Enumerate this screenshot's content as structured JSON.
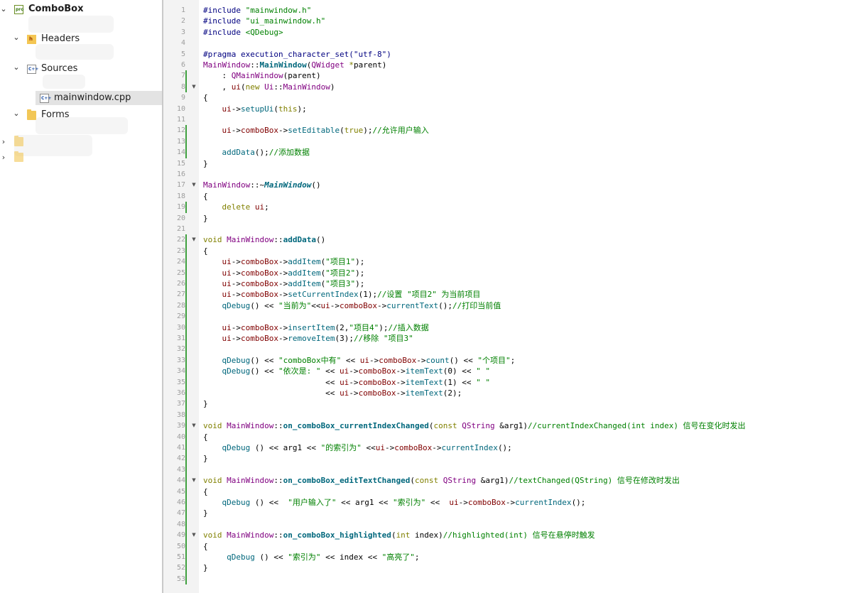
{
  "sidebar": {
    "items": [
      {
        "label": "ComboBox"
      },
      {
        "label": "Headers"
      },
      {
        "label": "Sources"
      },
      {
        "label": "mainwindow.cpp"
      },
      {
        "label": "Forms"
      }
    ]
  },
  "editor": {
    "lines": [
      {
        "n": "1",
        "t": [
          [
            "pre",
            "#include "
          ],
          [
            "str",
            "\"mainwindow.h\""
          ]
        ]
      },
      {
        "n": "2",
        "t": [
          [
            "pre",
            "#include "
          ],
          [
            "str",
            "\"ui_mainwindow.h\""
          ]
        ]
      },
      {
        "n": "3",
        "t": [
          [
            "pre",
            "#include "
          ],
          [
            "str",
            "<QDebug>"
          ]
        ]
      },
      {
        "n": "4",
        "t": []
      },
      {
        "n": "5",
        "t": [
          [
            "pre",
            "#pragma execution_character_set(\"utf-8\")"
          ]
        ]
      },
      {
        "n": "6",
        "t": [
          [
            "ty",
            "MainWindow"
          ],
          [
            "",
            "::"
          ],
          [
            "fnb",
            "MainWindow"
          ],
          [
            "",
            "("
          ],
          [
            "ty",
            "QWidget"
          ],
          [
            "",
            ""
          ],
          [
            "kw",
            " *"
          ],
          [
            "",
            "parent)"
          ]
        ]
      },
      {
        "n": "7",
        "t": [
          [
            "",
            "    : "
          ],
          [
            "ty",
            "QMainWindow"
          ],
          [
            "",
            "(parent)"
          ]
        ]
      },
      {
        "n": "8",
        "t": [
          [
            "",
            "    , "
          ],
          [
            "mb",
            "ui"
          ],
          [
            "",
            "("
          ],
          [
            "kw",
            "new"
          ],
          [
            "",
            ""
          ],
          [
            "ty",
            " Ui"
          ],
          [
            "",
            "::"
          ],
          [
            "ty",
            "MainWindow"
          ],
          [
            "",
            ")"
          ]
        ]
      },
      {
        "n": "9",
        "t": [
          [
            "",
            "{"
          ]
        ]
      },
      {
        "n": "10",
        "t": [
          [
            "",
            "    "
          ],
          [
            "mb",
            "ui"
          ],
          [
            "",
            "->"
          ],
          [
            "fn",
            "setupUi"
          ],
          [
            "",
            "("
          ],
          [
            "kw",
            "this"
          ],
          [
            "",
            ");"
          ]
        ]
      },
      {
        "n": "11",
        "t": []
      },
      {
        "n": "12",
        "t": [
          [
            "",
            "    "
          ],
          [
            "mb",
            "ui"
          ],
          [
            "",
            "->"
          ],
          [
            "mb",
            "comboBox"
          ],
          [
            "",
            "->"
          ],
          [
            "fn",
            "setEditable"
          ],
          [
            "",
            "("
          ],
          [
            "kw",
            "true"
          ],
          [
            "",
            ");"
          ],
          [
            "cm",
            "//允许用户输入"
          ]
        ]
      },
      {
        "n": "13",
        "t": []
      },
      {
        "n": "14",
        "t": [
          [
            "",
            "    "
          ],
          [
            "fn",
            "addData"
          ],
          [
            "",
            "();"
          ],
          [
            "cm",
            "//添加数据"
          ]
        ]
      },
      {
        "n": "15",
        "t": [
          [
            "",
            "}"
          ]
        ]
      },
      {
        "n": "16",
        "t": []
      },
      {
        "n": "17",
        "t": [
          [
            "ty",
            "MainWindow"
          ],
          [
            "",
            "::~"
          ],
          [
            "fni",
            "MainWindow"
          ],
          [
            "",
            "()"
          ]
        ]
      },
      {
        "n": "18",
        "t": [
          [
            "",
            "{"
          ]
        ]
      },
      {
        "n": "19",
        "t": [
          [
            "",
            "    "
          ],
          [
            "kw",
            "delete"
          ],
          [
            "",
            ""
          ],
          [
            "mb",
            " ui"
          ],
          [
            "",
            ";"
          ]
        ]
      },
      {
        "n": "20",
        "t": [
          [
            "",
            "}"
          ]
        ]
      },
      {
        "n": "21",
        "t": []
      },
      {
        "n": "22",
        "t": [
          [
            "kw",
            "void"
          ],
          [
            "",
            ""
          ],
          [
            "ty",
            " MainWindow"
          ],
          [
            "",
            "::"
          ],
          [
            "fnb",
            "addData"
          ],
          [
            "",
            "()"
          ]
        ]
      },
      {
        "n": "23",
        "t": [
          [
            "",
            "{"
          ]
        ]
      },
      {
        "n": "24",
        "t": [
          [
            "",
            "    "
          ],
          [
            "mb",
            "ui"
          ],
          [
            "",
            "->"
          ],
          [
            "mb",
            "comboBox"
          ],
          [
            "",
            "->"
          ],
          [
            "fn",
            "addItem"
          ],
          [
            "",
            "("
          ],
          [
            "str",
            "\"项目1\""
          ],
          [
            "",
            ");"
          ]
        ]
      },
      {
        "n": "25",
        "t": [
          [
            "",
            "    "
          ],
          [
            "mb",
            "ui"
          ],
          [
            "",
            "->"
          ],
          [
            "mb",
            "comboBox"
          ],
          [
            "",
            "->"
          ],
          [
            "fn",
            "addItem"
          ],
          [
            "",
            "("
          ],
          [
            "str",
            "\"项目2\""
          ],
          [
            "",
            ");"
          ]
        ]
      },
      {
        "n": "26",
        "t": [
          [
            "",
            "    "
          ],
          [
            "mb",
            "ui"
          ],
          [
            "",
            "->"
          ],
          [
            "mb",
            "comboBox"
          ],
          [
            "",
            "->"
          ],
          [
            "fn",
            "addItem"
          ],
          [
            "",
            "("
          ],
          [
            "str",
            "\"项目3\""
          ],
          [
            "",
            ");"
          ]
        ]
      },
      {
        "n": "27",
        "t": [
          [
            "",
            "    "
          ],
          [
            "mb",
            "ui"
          ],
          [
            "",
            "->"
          ],
          [
            "mb",
            "comboBox"
          ],
          [
            "",
            "->"
          ],
          [
            "fn",
            "setCurrentIndex"
          ],
          [
            "",
            "(1);"
          ],
          [
            "cm",
            "//设置 \"项目2\" 为当前项目"
          ]
        ]
      },
      {
        "n": "28",
        "t": [
          [
            "",
            "    "
          ],
          [
            "fn",
            "qDebug"
          ],
          [
            "",
            "() << "
          ],
          [
            "str",
            "\"当前为\""
          ],
          [
            "",
            ""
          ],
          [
            "",
            "<<"
          ],
          [
            "mb",
            "ui"
          ],
          [
            "",
            "->"
          ],
          [
            "mb",
            "comboBox"
          ],
          [
            "",
            "->"
          ],
          [
            "fn",
            "currentText"
          ],
          [
            "",
            "();"
          ],
          [
            "cm",
            "//打印当前值"
          ]
        ]
      },
      {
        "n": "29",
        "t": []
      },
      {
        "n": "30",
        "t": [
          [
            "",
            "    "
          ],
          [
            "mb",
            "ui"
          ],
          [
            "",
            "->"
          ],
          [
            "mb",
            "comboBox"
          ],
          [
            "",
            "->"
          ],
          [
            "fn",
            "insertItem"
          ],
          [
            "",
            "(2,"
          ],
          [
            "str",
            "\"项目4\""
          ],
          [
            "",
            ");"
          ],
          [
            "cm",
            "//插入数据"
          ]
        ]
      },
      {
        "n": "31",
        "t": [
          [
            "",
            "    "
          ],
          [
            "mb",
            "ui"
          ],
          [
            "",
            "->"
          ],
          [
            "mb",
            "comboBox"
          ],
          [
            "",
            "->"
          ],
          [
            "fn",
            "removeItem"
          ],
          [
            "",
            "(3);"
          ],
          [
            "cm",
            "//移除 \"项目3\""
          ]
        ]
      },
      {
        "n": "32",
        "t": []
      },
      {
        "n": "33",
        "t": [
          [
            "",
            "    "
          ],
          [
            "fn",
            "qDebug"
          ],
          [
            "",
            "() << "
          ],
          [
            "str",
            "\"comboBox中有\""
          ],
          [
            "",
            " << "
          ],
          [
            "mb",
            "ui"
          ],
          [
            "",
            "->"
          ],
          [
            "mb",
            "comboBox"
          ],
          [
            "",
            "->"
          ],
          [
            "fn",
            "count"
          ],
          [
            "",
            "() << "
          ],
          [
            "str",
            "\"个项目\""
          ],
          [
            "",
            ";"
          ]
        ]
      },
      {
        "n": "34",
        "t": [
          [
            "",
            "    "
          ],
          [
            "fn",
            "qDebug"
          ],
          [
            "",
            "() << "
          ],
          [
            "str",
            "\"依次是: \""
          ],
          [
            "",
            " << "
          ],
          [
            "mb",
            "ui"
          ],
          [
            "",
            "->"
          ],
          [
            "mb",
            "comboBox"
          ],
          [
            "",
            "->"
          ],
          [
            "fn",
            "itemText"
          ],
          [
            "",
            "(0) << "
          ],
          [
            "str",
            "\" \""
          ]
        ]
      },
      {
        "n": "35",
        "t": [
          [
            "",
            "                          << "
          ],
          [
            "mb",
            "ui"
          ],
          [
            "",
            "->"
          ],
          [
            "mb",
            "comboBox"
          ],
          [
            "",
            "->"
          ],
          [
            "fn",
            "itemText"
          ],
          [
            "",
            "(1) << "
          ],
          [
            "str",
            "\" \""
          ]
        ]
      },
      {
        "n": "36",
        "t": [
          [
            "",
            "                          << "
          ],
          [
            "mb",
            "ui"
          ],
          [
            "",
            "->"
          ],
          [
            "mb",
            "comboBox"
          ],
          [
            "",
            "->"
          ],
          [
            "fn",
            "itemText"
          ],
          [
            "",
            "(2);"
          ]
        ]
      },
      {
        "n": "37",
        "t": [
          [
            "",
            "}"
          ]
        ]
      },
      {
        "n": "38",
        "t": []
      },
      {
        "n": "39",
        "t": [
          [
            "kw",
            "void"
          ],
          [
            "",
            ""
          ],
          [
            "ty",
            " MainWindow"
          ],
          [
            "",
            "::"
          ],
          [
            "fnb",
            "on_comboBox_currentIndexChanged"
          ],
          [
            "",
            "("
          ],
          [
            "kw",
            "const"
          ],
          [
            "",
            ""
          ],
          [
            "ty",
            " QString"
          ],
          [
            "",
            " &arg1)"
          ],
          [
            "cm",
            "//currentIndexChanged(int index) 信号在变化时发出"
          ]
        ]
      },
      {
        "n": "40",
        "t": [
          [
            "",
            "{"
          ]
        ]
      },
      {
        "n": "41",
        "t": [
          [
            "",
            "    "
          ],
          [
            "fn",
            "qDebug"
          ],
          [
            "",
            " () << arg1 << "
          ],
          [
            "str",
            "\"的索引为\""
          ],
          [
            "",
            " <<"
          ],
          [
            "mb",
            "ui"
          ],
          [
            "",
            "->"
          ],
          [
            "mb",
            "comboBox"
          ],
          [
            "",
            "->"
          ],
          [
            "fn",
            "currentIndex"
          ],
          [
            "",
            "();"
          ]
        ]
      },
      {
        "n": "42",
        "t": [
          [
            "",
            "}"
          ]
        ]
      },
      {
        "n": "43",
        "t": []
      },
      {
        "n": "44",
        "t": [
          [
            "kw",
            "void"
          ],
          [
            "",
            ""
          ],
          [
            "ty",
            " MainWindow"
          ],
          [
            "",
            "::"
          ],
          [
            "fnb",
            "on_comboBox_editTextChanged"
          ],
          [
            "",
            "("
          ],
          [
            "kw",
            "const"
          ],
          [
            "",
            ""
          ],
          [
            "ty",
            " QString"
          ],
          [
            "",
            " &arg1)"
          ],
          [
            "cm",
            "//textChanged(QString) 信号在修改时发出"
          ]
        ]
      },
      {
        "n": "45",
        "t": [
          [
            "",
            "{"
          ]
        ]
      },
      {
        "n": "46",
        "t": [
          [
            "",
            "    "
          ],
          [
            "fn",
            "qDebug"
          ],
          [
            "",
            " () <<  "
          ],
          [
            "str",
            "\"用户输入了\""
          ],
          [
            "",
            " << arg1 << "
          ],
          [
            "str",
            "\"索引为\""
          ],
          [
            "",
            " <<  "
          ],
          [
            "mb",
            "ui"
          ],
          [
            "",
            "->"
          ],
          [
            "mb",
            "comboBox"
          ],
          [
            "",
            "->"
          ],
          [
            "fn",
            "currentIndex"
          ],
          [
            "",
            "();"
          ]
        ]
      },
      {
        "n": "47",
        "t": [
          [
            "",
            "}"
          ]
        ]
      },
      {
        "n": "48",
        "t": []
      },
      {
        "n": "49",
        "t": [
          [
            "kw",
            "void"
          ],
          [
            "",
            ""
          ],
          [
            "ty",
            " MainWindow"
          ],
          [
            "",
            "::"
          ],
          [
            "fnb",
            "on_comboBox_highlighted"
          ],
          [
            "",
            "("
          ],
          [
            "kw",
            "int"
          ],
          [
            "",
            " index)"
          ],
          [
            "cm",
            "//highlighted(int) 信号在悬停时触发"
          ]
        ]
      },
      {
        "n": "50",
        "t": [
          [
            "",
            "{"
          ]
        ]
      },
      {
        "n": "51",
        "t": [
          [
            "",
            "     "
          ],
          [
            "fn",
            "qDebug"
          ],
          [
            "",
            " () << "
          ],
          [
            "str",
            "\"索引为\""
          ],
          [
            "",
            " << index << "
          ],
          [
            "str",
            "\"高亮了\""
          ],
          [
            "",
            ";"
          ]
        ]
      },
      {
        "n": "52",
        "t": [
          [
            "",
            "}"
          ]
        ]
      },
      {
        "n": "53",
        "t": []
      }
    ],
    "folded_lines": [
      "8",
      "17",
      "22",
      "39",
      "44",
      "49"
    ]
  }
}
